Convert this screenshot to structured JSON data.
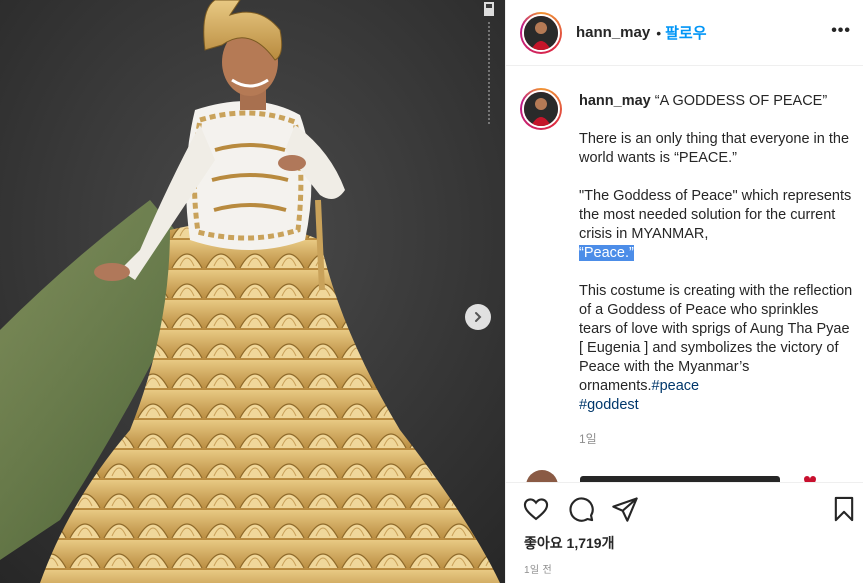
{
  "post": {
    "username": "hann_may",
    "follow_label": "팔로우",
    "dot": "•",
    "more_label": "•••"
  },
  "caption": {
    "username": "hann_may",
    "title": "“A GODDESS OF PEACE”",
    "para1": "There is an only thing that everyone in the world wants is “PEACE.”",
    "para2": "\"The Goddess of Peace\" which represents the most needed solution for the current crisis in MYANMAR,",
    "para2_highlight": "“Peace.”",
    "para3": "This costume is creating with the reflection of a Goddess of Peace who sprinkles tears of love with sprigs of Aung Tha Pyae [ Eugenia ] and symbolizes the victory of Peace with the Myanmar’s ornaments.",
    "hashtag1": "#peace",
    "hashtag2": "#goddest",
    "time_ago": "1일"
  },
  "actions": {
    "like_icon": "heart-icon",
    "comment_icon": "comment-icon",
    "share_icon": "send-icon",
    "save_icon": "bookmark-icon",
    "likes_text": "좋아요 1,719개",
    "post_time": "1일 전"
  },
  "colors": {
    "link_blue": "#0095f6",
    "hashtag": "#00376b",
    "highlight": "#4c8de8",
    "muted": "#8e8e8e"
  }
}
